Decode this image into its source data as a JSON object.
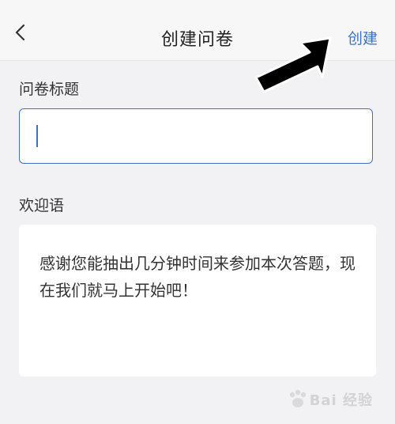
{
  "navbar": {
    "title": "创建问卷",
    "action_label": "创建"
  },
  "form": {
    "title_label": "问卷标题",
    "title_value": "",
    "welcome_label": "欢迎语",
    "welcome_text": "感谢您能抽出几分钟时间来参加本次答题，现在我们就马上开始吧！"
  },
  "colors": {
    "accent": "#3f6fd1",
    "background": "#f2f2f4"
  },
  "icons": {
    "back": "chevron-left-icon",
    "annotation": "arrow-icon"
  },
  "watermark": {
    "text": "Bai 经验"
  }
}
